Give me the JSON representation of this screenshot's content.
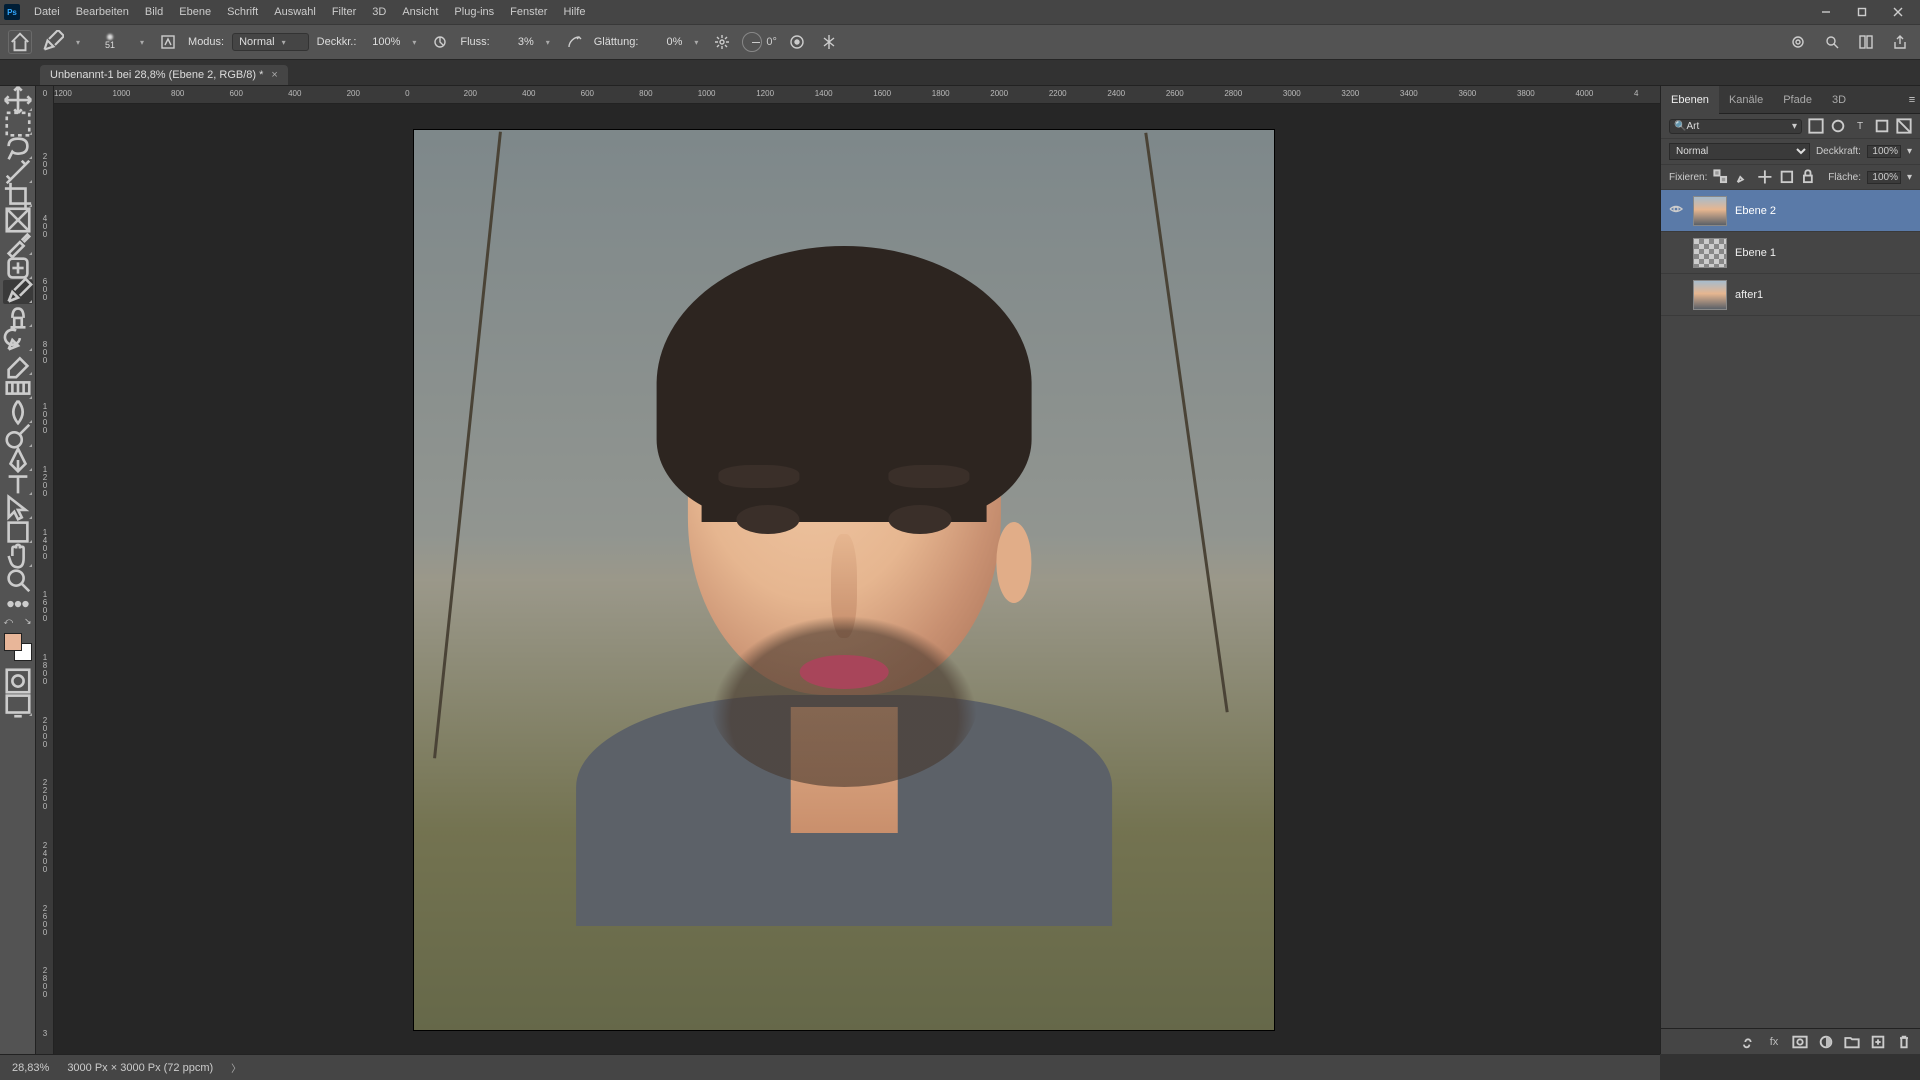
{
  "app_icon": "Ps",
  "menu": [
    "Datei",
    "Bearbeiten",
    "Bild",
    "Ebene",
    "Schrift",
    "Auswahl",
    "Filter",
    "3D",
    "Ansicht",
    "Plug-ins",
    "Fenster",
    "Hilfe"
  ],
  "options": {
    "brush_size": "51",
    "mode_label": "Modus:",
    "mode_value": "Normal",
    "opacity_label": "Deckkr.:",
    "opacity_value": "100%",
    "flow_label": "Fluss:",
    "flow_value": "3%",
    "smoothing_label": "Glättung:",
    "smoothing_value": "0%",
    "angle_value": "0°"
  },
  "document": {
    "tab_title": "Unbenannt-1 bei 28,8% (Ebene 2, RGB/8) *"
  },
  "hruler_ticks": [
    "1200",
    "1000",
    "800",
    "600",
    "400",
    "200",
    "0",
    "200",
    "400",
    "600",
    "800",
    "1000",
    "1200",
    "1400",
    "1600",
    "1800",
    "2000",
    "2200",
    "2400",
    "2600",
    "2800",
    "3000",
    "3200",
    "3400",
    "3600",
    "3800",
    "4000",
    "4"
  ],
  "vruler_ticks": [
    "0",
    "200",
    "400",
    "600",
    "800",
    "1000",
    "1200",
    "1400",
    "1600",
    "1800",
    "2000",
    "2200",
    "2400",
    "2600",
    "2800",
    "3"
  ],
  "panels": {
    "tabs": [
      "Ebenen",
      "Kanäle",
      "Pfade",
      "3D"
    ],
    "search_placeholder": "Art",
    "blend_mode": "Normal",
    "opacity_label": "Deckkraft:",
    "opacity_value": "100%",
    "lock_label": "Fixieren:",
    "fill_label": "Fläche:",
    "fill_value": "100%",
    "layers": [
      {
        "name": "Ebene 2",
        "visible": true,
        "selected": true,
        "thumb": "photo"
      },
      {
        "name": "Ebene 1",
        "visible": false,
        "selected": false,
        "thumb": "trans"
      },
      {
        "name": "after1",
        "visible": false,
        "selected": false,
        "thumb": "photo"
      }
    ]
  },
  "status": {
    "zoom": "28,83%",
    "docinfo": "3000 Px × 3000 Px (72 ppcm)"
  },
  "colors": {
    "fg": "#e8b699",
    "bg": "#ffffff"
  }
}
